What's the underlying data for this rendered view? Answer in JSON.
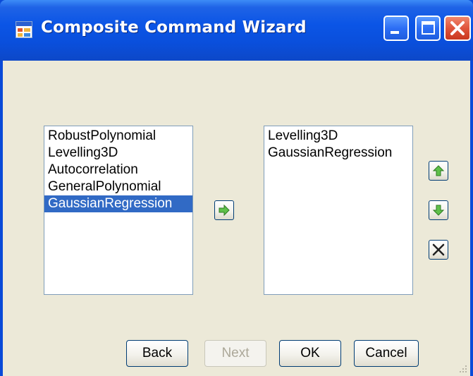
{
  "window": {
    "title": "Composite Command Wizard",
    "icon": "app-window-icon",
    "controls": [
      "minimize-icon",
      "maximize-icon",
      "close-icon"
    ]
  },
  "available_list": {
    "items": [
      {
        "label": "RobustPolynomial",
        "selected": false
      },
      {
        "label": "Levelling3D",
        "selected": false
      },
      {
        "label": "Autocorrelation",
        "selected": false
      },
      {
        "label": "GeneralPolynomial",
        "selected": false
      },
      {
        "label": "GaussianRegression",
        "selected": true
      }
    ]
  },
  "selected_list": {
    "items": [
      {
        "label": "Levelling3D"
      },
      {
        "label": "GaussianRegression"
      }
    ]
  },
  "actions": {
    "add": "arrow-right-icon",
    "move_up": "arrow-up-icon",
    "move_down": "arrow-down-icon",
    "remove": "x-icon"
  },
  "buttons": {
    "back": "Back",
    "next": "Next",
    "ok": "OK",
    "cancel": "Cancel"
  },
  "colors": {
    "titlebar": "#0a4fdc",
    "client_bg": "#ece9d8",
    "selection": "#316ac5",
    "arrow_icon": "#3c9a2c"
  }
}
